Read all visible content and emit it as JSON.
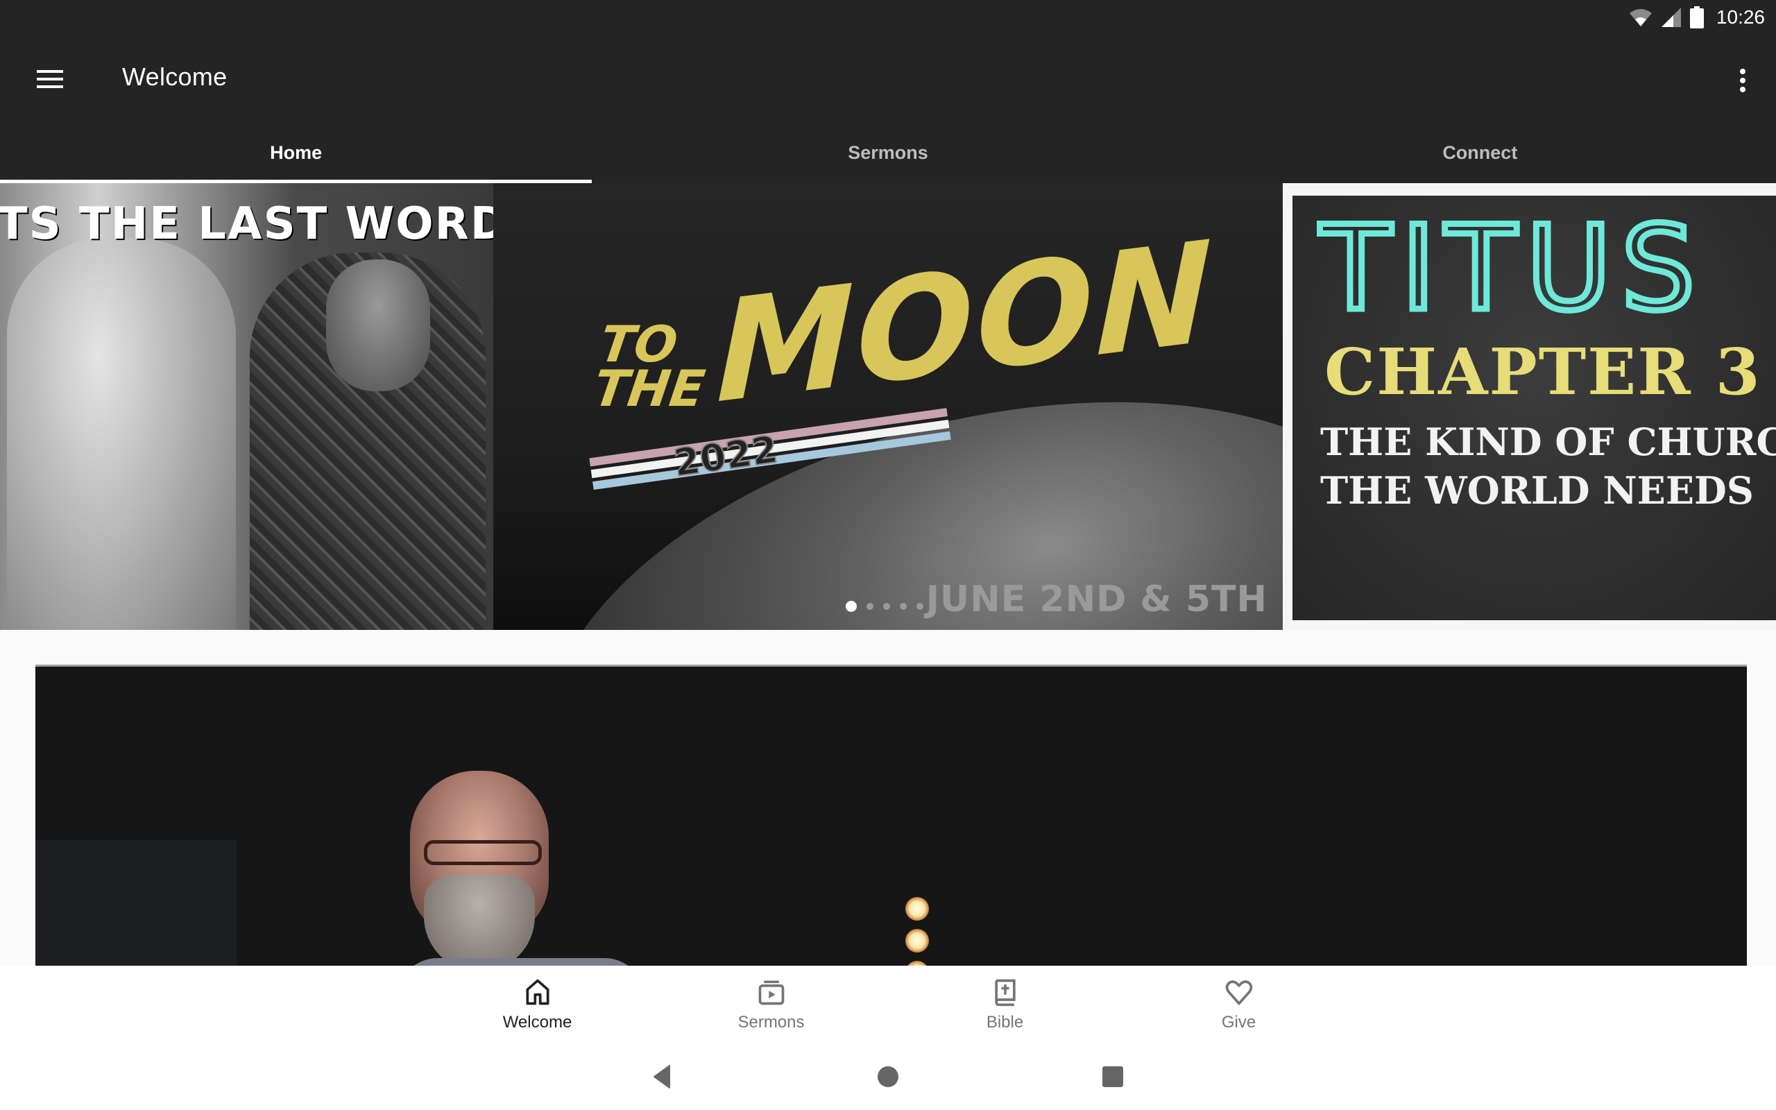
{
  "status_bar": {
    "time": "10:26",
    "icons": [
      "wifi-icon",
      "cellular-signal-icon",
      "battery-icon"
    ]
  },
  "app_bar": {
    "title": "Welcome",
    "menu_icon": "hamburger-menu-icon",
    "overflow_icon": "more-vertical-icon"
  },
  "tabs": [
    {
      "label": "Home",
      "active": true
    },
    {
      "label": "Sermons",
      "active": false
    },
    {
      "label": "Connect",
      "active": false
    }
  ],
  "carousel": {
    "slides": [
      {
        "title_text": "TS THE LAST WORD"
      },
      {
        "line1": "TO",
        "line2": "THE",
        "headline": "MOON",
        "year": "2022",
        "date": "JUNE 2ND & 5TH"
      },
      {
        "title": "TITUS",
        "chapter": "CHAPTER 3",
        "subtitle_line1": "THE KIND OF CHURCH",
        "subtitle_line2": "THE WORLD NEEDS"
      }
    ],
    "page_count": 5,
    "active_page": 1,
    "colors": {
      "moon_yellow": "#d8c65a",
      "titus_teal": "#6ee9d9",
      "chapter_yellow": "#e6dc78"
    }
  },
  "video_card": {
    "label": "sermon-video-preview"
  },
  "bottom_nav": [
    {
      "label": "Welcome",
      "icon": "home-icon",
      "active": true
    },
    {
      "label": "Sermons",
      "icon": "video-library-icon",
      "active": false
    },
    {
      "label": "Bible",
      "icon": "bible-icon",
      "active": false
    },
    {
      "label": "Give",
      "icon": "heart-icon",
      "active": false
    }
  ],
  "system_nav": {
    "buttons": [
      "back",
      "home",
      "recents"
    ]
  }
}
